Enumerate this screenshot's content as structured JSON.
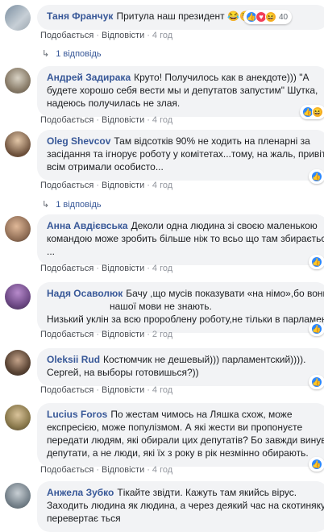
{
  "colors": {
    "author": "#385898",
    "bubble": "#f2f3f5",
    "meta": "#90949c",
    "like": "#2d88ff"
  },
  "comments": [
    {
      "author": "Таня Франчук",
      "lines": [
        "Притула наш президент 😂😚"
      ],
      "actions": {
        "like": "Подобається",
        "reply": "Відповісти",
        "time": "4 год"
      },
      "reactions": {
        "icons": [
          "like-icon",
          "love-icon",
          "haha-icon"
        ],
        "count": "40"
      },
      "replies": "1 відповідь"
    },
    {
      "author": "Андрей Задирака",
      "lines": [
        "Круто! Получилось как в анекдоте))) \"А",
        "будете хорошо себя вести мы и депутатов запустим\" Шутка,",
        "надеюсь получилась не злая."
      ],
      "actions": {
        "like": "Подобається",
        "reply": "Відповісти",
        "time": "4 год"
      },
      "reactions": {
        "icons": [
          "like-icon",
          "haha-icon"
        ],
        "count": ""
      }
    },
    {
      "author": "Oleg Shevcov",
      "lines": [
        "Там відсотків 90% не ходить на пленарні за",
        "засідання та ігнорує роботу у комітетах...тому, на жаль, привіт не",
        "всім отримали особисто..."
      ],
      "actions": {
        "like": "Подобається",
        "reply": "Відповісти",
        "time": "4 год"
      },
      "reactions": {
        "icons": [
          "like-icon"
        ],
        "count": ""
      },
      "replies": "1 відповідь"
    },
    {
      "author": "Анна Авдієвська",
      "lines": [
        "Деколи одна людина зі своєю маленькою",
        "командою може зробить більше ніж то всьо що там збирається.",
        "..."
      ],
      "actions": {
        "like": "Подобається",
        "reply": "Відповісти",
        "time": "4 год"
      },
      "reactions": {
        "icons": [
          "like-icon"
        ],
        "count": ""
      }
    },
    {
      "author": "Надя Осаволюк",
      "lines": [
        "Бачу ,що мусів показувати «на німо»,бо вони ж",
        "нашої мови не знають.",
        "Низький уклін за всю пророблену роботу,не тільки в парламенті."
      ],
      "actions": {
        "like": "Подобається",
        "reply": "Відповісти",
        "time": "2 год"
      },
      "reactions": {
        "icons": [
          "like-icon"
        ],
        "count": ""
      }
    },
    {
      "author": "Oleksii Rud",
      "lines": [
        "Костюмчик не дешевый))) парламентский)))).",
        "Сергей, на выборы готовишься?))"
      ],
      "actions": {
        "like": "Подобається",
        "reply": "Відповісти",
        "time": "4 год"
      },
      "reactions": {
        "icons": [
          "like-icon"
        ],
        "count": ""
      }
    },
    {
      "author": "Lucius Foros",
      "lines": [
        "По жестам чимось на Ляшка схож, може",
        "експресією, може популізмом. А які жести ви пропонуєте",
        "передати людям, які обирали цих депутатів? Бо завжди винуваті",
        "депутати, а не люди, які їх з року в рік незмінно обирають."
      ],
      "actions": {
        "like": "Подобається",
        "reply": "Відповісти",
        "time": "4 год"
      },
      "reactions": {
        "icons": [
          "like-icon"
        ],
        "count": ""
      }
    },
    {
      "author": "Анжела Зубко",
      "lines": [
        "Тікайте звідти. Кажуть там якийсь вірус.",
        "Заходить людина як людина, а через деякий час на скотиняку",
        "перевертає ться"
      ],
      "actions": {}
    }
  ]
}
